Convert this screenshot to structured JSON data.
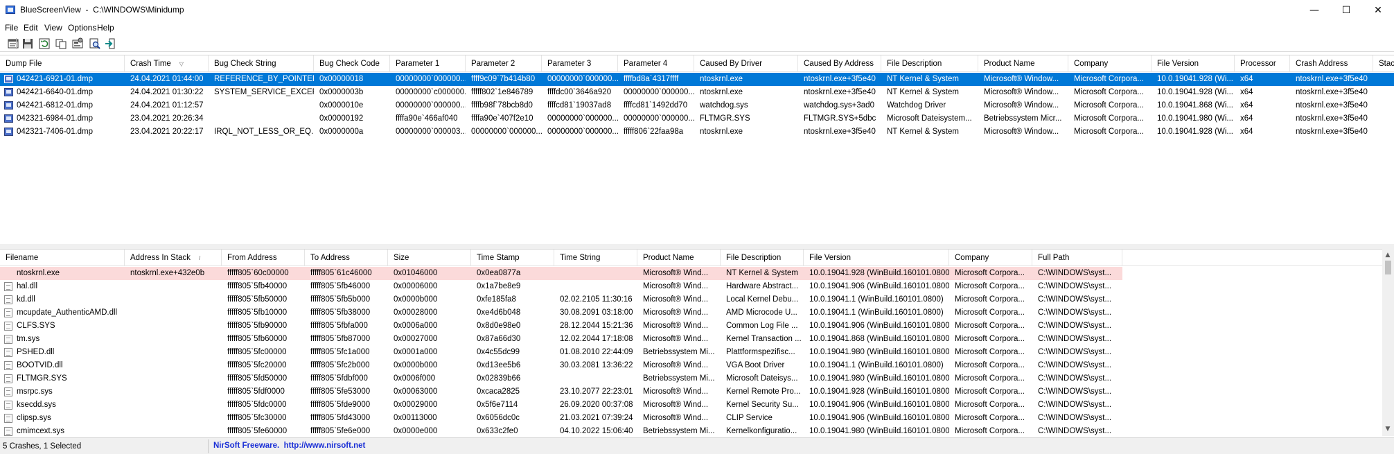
{
  "window": {
    "title": "BlueScreenView  -  C:\\WINDOWS\\Minidump",
    "minimize": "—",
    "maximize": "☐",
    "close": "✕"
  },
  "menu": [
    "File",
    "Edit",
    "View",
    "Options",
    "Help"
  ],
  "toolbar": [
    "properties-icon",
    "save-icon",
    "refresh-icon",
    "copy-icon",
    "advanced-options-icon",
    "find-icon",
    "exit-icon"
  ],
  "crash_list": {
    "columns": [
      "Dump File",
      "Crash Time",
      "Bug Check String",
      "Bug Check Code",
      "Parameter 1",
      "Parameter 2",
      "Parameter 3",
      "Parameter 4",
      "Caused By Driver",
      "Caused By Address",
      "File Description",
      "Product Name",
      "Company",
      "File Version",
      "Processor",
      "Crash Address",
      "Stac"
    ],
    "sort_indicator": "▽",
    "rows": [
      [
        "042421-6921-01.dmp",
        "24.04.2021 01:44:00",
        "REFERENCE_BY_POINTER",
        "0x00000018",
        "00000000`000000...",
        "ffff9c09`7b414b80",
        "00000000`000000...",
        "ffffbd8a`4317ffff",
        "ntoskrnl.exe",
        "ntoskrnl.exe+3f5e40",
        "NT Kernel & System",
        "Microsoft® Window...",
        "Microsoft Corpora...",
        "10.0.19041.928 (Wi...",
        "x64",
        "ntoskrnl.exe+3f5e40",
        ""
      ],
      [
        "042421-6640-01.dmp",
        "24.04.2021 01:30:22",
        "SYSTEM_SERVICE_EXCEP...",
        "0x0000003b",
        "00000000`c000000...",
        "fffff802`1e846789",
        "ffffdc00`3646a920",
        "00000000`000000...",
        "ntoskrnl.exe",
        "ntoskrnl.exe+3f5e40",
        "NT Kernel & System",
        "Microsoft® Window...",
        "Microsoft Corpora...",
        "10.0.19041.928 (Wi...",
        "x64",
        "ntoskrnl.exe+3f5e40",
        ""
      ],
      [
        "042421-6812-01.dmp",
        "24.04.2021 01:12:57",
        "",
        "0x0000010e",
        "00000000`000000...",
        "ffffb98f`78bcb8d0",
        "ffffcd81`19037ad8",
        "ffffcd81`1492dd70",
        "watchdog.sys",
        "watchdog.sys+3ad0",
        "Watchdog Driver",
        "Microsoft® Window...",
        "Microsoft Corpora...",
        "10.0.19041.868 (Wi...",
        "x64",
        "ntoskrnl.exe+3f5e40",
        ""
      ],
      [
        "042321-6984-01.dmp",
        "23.04.2021 20:26:34",
        "",
        "0x00000192",
        "ffffa90e`466af040",
        "ffffa90e`407f2e10",
        "00000000`000000...",
        "00000000`000000...",
        "FLTMGR.SYS",
        "FLTMGR.SYS+5dbc",
        "Microsoft Dateisystem...",
        "Betriebssystem Micr...",
        "Microsoft Corpora...",
        "10.0.19041.980 (Wi...",
        "x64",
        "ntoskrnl.exe+3f5e40",
        ""
      ],
      [
        "042321-7406-01.dmp",
        "23.04.2021 20:22:17",
        "IRQL_NOT_LESS_OR_EQ...",
        "0x0000000a",
        "00000000`000003...",
        "00000000`000000...",
        "00000000`000000...",
        "fffff806`22faa98a",
        "ntoskrnl.exe",
        "ntoskrnl.exe+3f5e40",
        "NT Kernel & System",
        "Microsoft® Window...",
        "Microsoft Corpora...",
        "10.0.19041.928 (Wi...",
        "x64",
        "ntoskrnl.exe+3f5e40",
        ""
      ]
    ]
  },
  "driver_list": {
    "columns": [
      "Filename",
      "Address In Stack",
      "From Address",
      "To Address",
      "Size",
      "Time Stamp",
      "Time String",
      "Product Name",
      "File Description",
      "File Version",
      "Company",
      "Full Path"
    ],
    "sort_indicator": "/",
    "rows": [
      [
        "ntoskrnl.exe",
        "ntoskrnl.exe+432e0b",
        "fffff805`60c00000",
        "fffff805`61c46000",
        "0x01046000",
        "0x0ea0877a",
        "",
        "Microsoft® Wind...",
        "NT Kernel & System",
        "10.0.19041.928 (WinBuild.160101.0800)",
        "Microsoft Corpora...",
        "C:\\WINDOWS\\syst..."
      ],
      [
        "hal.dll",
        "",
        "fffff805`5fb40000",
        "fffff805`5fb46000",
        "0x00006000",
        "0x1a7be8e9",
        "",
        "Microsoft® Wind...",
        "Hardware Abstract...",
        "10.0.19041.906 (WinBuild.160101.0800)",
        "Microsoft Corpora...",
        "C:\\WINDOWS\\syst..."
      ],
      [
        "kd.dll",
        "",
        "fffff805`5fb50000",
        "fffff805`5fb5b000",
        "0x0000b000",
        "0xfe185fa8",
        "02.02.2105 11:30:16",
        "Microsoft® Wind...",
        "Local Kernel Debu...",
        "10.0.19041.1 (WinBuild.160101.0800)",
        "Microsoft Corpora...",
        "C:\\WINDOWS\\syst..."
      ],
      [
        "mcupdate_AuthenticAMD.dll",
        "",
        "fffff805`5fb10000",
        "fffff805`5fb38000",
        "0x00028000",
        "0xe4d6b048",
        "30.08.2091 03:18:00",
        "Microsoft® Wind...",
        "AMD Microcode U...",
        "10.0.19041.1 (WinBuild.160101.0800)",
        "Microsoft Corpora...",
        "C:\\WINDOWS\\syst..."
      ],
      [
        "CLFS.SYS",
        "",
        "fffff805`5fb90000",
        "fffff805`5fbfa000",
        "0x0006a000",
        "0x8d0e98e0",
        "28.12.2044 15:21:36",
        "Microsoft® Wind...",
        "Common Log File ...",
        "10.0.19041.906 (WinBuild.160101.0800)",
        "Microsoft Corpora...",
        "C:\\WINDOWS\\syst..."
      ],
      [
        "tm.sys",
        "",
        "fffff805`5fb60000",
        "fffff805`5fb87000",
        "0x00027000",
        "0x87a66d30",
        "12.02.2044 17:18:08",
        "Microsoft® Wind...",
        "Kernel Transaction ...",
        "10.0.19041.868 (WinBuild.160101.0800)",
        "Microsoft Corpora...",
        "C:\\WINDOWS\\syst..."
      ],
      [
        "PSHED.dll",
        "",
        "fffff805`5fc00000",
        "fffff805`5fc1a000",
        "0x0001a000",
        "0x4c55dc99",
        "01.08.2010 22:44:09",
        "Betriebssystem Mi...",
        "Plattformspezifisc...",
        "10.0.19041.980 (WinBuild.160101.0800)",
        "Microsoft Corpora...",
        "C:\\WINDOWS\\syst..."
      ],
      [
        "BOOTVID.dll",
        "",
        "fffff805`5fc20000",
        "fffff805`5fc2b000",
        "0x0000b000",
        "0xd13ee5b6",
        "30.03.2081 13:36:22",
        "Microsoft® Wind...",
        "VGA Boot Driver",
        "10.0.19041.1 (WinBuild.160101.0800)",
        "Microsoft Corpora...",
        "C:\\WINDOWS\\syst..."
      ],
      [
        "FLTMGR.SYS",
        "",
        "fffff805`5fd50000",
        "fffff805`5fdbf000",
        "0x0006f000",
        "0x02839b66",
        "",
        "Betriebssystem Mi...",
        "Microsoft Dateisys...",
        "10.0.19041.980 (WinBuild.160101.0800)",
        "Microsoft Corpora...",
        "C:\\WINDOWS\\syst..."
      ],
      [
        "msrpc.sys",
        "",
        "fffff805`5fdf0000",
        "fffff805`5fe53000",
        "0x00063000",
        "0xcaca2825",
        "23.10.2077 22:23:01",
        "Microsoft® Wind...",
        "Kernel Remote Pro...",
        "10.0.19041.928 (WinBuild.160101.0800)",
        "Microsoft Corpora...",
        "C:\\WINDOWS\\syst..."
      ],
      [
        "ksecdd.sys",
        "",
        "fffff805`5fdc0000",
        "fffff805`5fde9000",
        "0x00029000",
        "0x5f6e7114",
        "26.09.2020 00:37:08",
        "Microsoft® Wind...",
        "Kernel Security Su...",
        "10.0.19041.906 (WinBuild.160101.0800)",
        "Microsoft Corpora...",
        "C:\\WINDOWS\\syst..."
      ],
      [
        "clipsp.sys",
        "",
        "fffff805`5fc30000",
        "fffff805`5fd43000",
        "0x00113000",
        "0x6056dc0c",
        "21.03.2021 07:39:24",
        "Microsoft® Wind...",
        "CLIP Service",
        "10.0.19041.906 (WinBuild.160101.0800)",
        "Microsoft Corpora...",
        "C:\\WINDOWS\\syst..."
      ],
      [
        "cmimcext.sys",
        "",
        "fffff805`5fe60000",
        "fffff805`5fe6e000",
        "0x0000e000",
        "0x633c2fe0",
        "04.10.2022 15:06:40",
        "Betriebssystem Mi...",
        "Kernelkonfiguratio...",
        "10.0.19041.980 (WinBuild.160101.0800)",
        "Microsoft Corpora...",
        "C:\\WINDOWS\\syst..."
      ]
    ]
  },
  "status": {
    "count": "5 Crashes, 1 Selected",
    "credit": "NirSoft Freeware.  http://www.nirsoft.net"
  },
  "colors": {
    "selection": "#0078d7",
    "highlight_row": "#fbdada",
    "credit_link": "#1a2fd6"
  }
}
